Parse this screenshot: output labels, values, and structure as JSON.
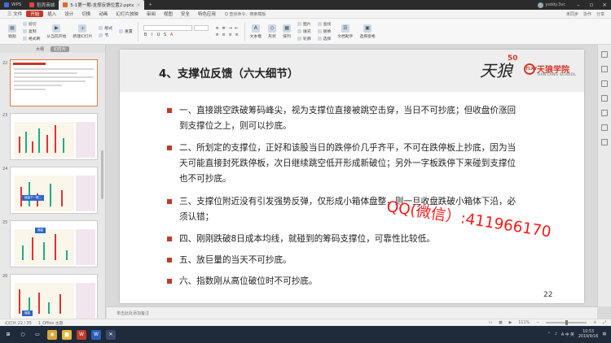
{
  "tabs": [
    {
      "label": "WPS",
      "color": "#3a6fd8"
    },
    {
      "label": "稻壳商城",
      "color": "#e0443a"
    },
    {
      "label": "5-1第一期-支撑反馈位置2.pptx",
      "color": "#e06a2b",
      "active": true
    }
  ],
  "user": {
    "name": "ysddy.3vc"
  },
  "menu": {
    "items": [
      "三 文件",
      "开始",
      "插入",
      "设计",
      "切换",
      "动画",
      "幻灯片放映",
      "审阅",
      "视图",
      "安全",
      "特色应用"
    ],
    "active_index": 1,
    "search": "Q 查找命令、搜索模板",
    "right": [
      "未同步",
      "协作",
      "分享"
    ]
  },
  "ribbon": {
    "big": [
      {
        "label": "粘贴",
        "icon": "paste-icon"
      },
      {
        "label": "从当前开始",
        "icon": "play-icon"
      },
      {
        "label": "新建幻灯片",
        "icon": "new-slide-icon"
      }
    ],
    "small1": [
      "剪切",
      "复制",
      "格式刷"
    ],
    "small2": [
      "版式",
      "节"
    ],
    "small3": [
      "重置"
    ],
    "right_big": [
      {
        "label": "文本框",
        "icon": "textbox-icon"
      },
      {
        "label": "形状",
        "icon": "shape-icon"
      },
      {
        "label": "排列",
        "icon": "arrange-icon"
      },
      {
        "label": "文档助手",
        "icon": "assistant-icon"
      },
      {
        "label": "选择窗格",
        "icon": "select-pane-icon"
      }
    ],
    "right_small": [
      "图片",
      "填充",
      "轮廓"
    ],
    "right_small2": [
      "查找",
      "替换",
      "选择"
    ],
    "font_buttons": [
      "B",
      "I",
      "U",
      "S",
      "A"
    ]
  },
  "left_panel": {
    "tabs": [
      "大纲",
      "幻灯片"
    ],
    "active_tab": 1,
    "thumb_numbers": [
      "22",
      "23",
      "24",
      "25",
      "26"
    ],
    "thumb_labels": [
      "缩量下一根二",
      "缩量",
      "缩量"
    ]
  },
  "slide": {
    "title": "4、支撑位反馈（六大细节）",
    "logo": {
      "script": "天狼",
      "number": "50",
      "badge": "TLXY",
      "name": "天狼学院",
      "en": "TIAN LANG SCHOOL"
    },
    "bullets": [
      [
        "一、直接跳空跌破筹码峰尖，视为支撑位直接被跳空击穿，当日不可抄底；但收盘价涨回",
        "到支撑位之上，则可以抄底。"
      ],
      [
        "二、所划定的支撑位，正好和该股当日的跌停价几乎齐平，不可在跌停板上抄底，因为当",
        "天可能直接封死跌停板，次日继续跳空低开形成新破位；另外一字板跌停下来碰到支撑位",
        "也不可抄底。"
      ],
      [
        "三、支撑位附近没有引发强势反弹，仅形成小箱体盘整，则一旦收盘跌破小箱体下沿，必",
        "须认错；"
      ],
      [
        "四、刚刚跌破8日成本均线，就碰到的筹码支撑位，可靠性比较低。"
      ],
      [
        "五、放巨量的当天不可抄底。"
      ],
      [
        "六、指数刚从高位破位时不可抄底。"
      ]
    ],
    "page_number": "22",
    "watermark": "QQ(微信）:411966170"
  },
  "notes": {
    "placeholder": "单击此处添加备注"
  },
  "status": {
    "slide_info": "幻灯片 22 / 35",
    "theme": "1_Office 主题",
    "zoom": "111%",
    "zoom_fraction": 0.5
  },
  "taskbar": {
    "time": "10:53",
    "date": "2019/9/16",
    "lang": "A 中 英",
    "apps": [
      {
        "name": "windows-icon",
        "color": "#1f2a3a",
        "glyph": "⊞"
      },
      {
        "name": "search-icon",
        "color": "#1f2a3a",
        "glyph": "○"
      },
      {
        "name": "task-view-icon",
        "color": "#1f2a3a",
        "glyph": "▭"
      },
      {
        "name": "chrome-icon",
        "color": "#d9a43a",
        "glyph": "◉"
      },
      {
        "name": "explorer-icon",
        "color": "#e6b93a",
        "glyph": "▆"
      },
      {
        "name": "wps-icon",
        "color": "#c23a2b",
        "glyph": "W"
      },
      {
        "name": "word-icon",
        "color": "#2b5fb7",
        "glyph": "W"
      },
      {
        "name": "app-icon",
        "color": "#3a4a6a",
        "glyph": "✕"
      }
    ]
  }
}
